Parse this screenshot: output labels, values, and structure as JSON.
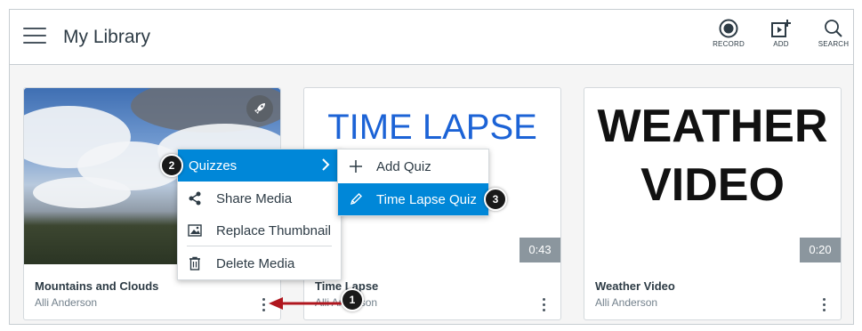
{
  "header": {
    "title": "My Library",
    "buttons": [
      {
        "label": "RECORD",
        "icon": "record-icon"
      },
      {
        "label": "ADD",
        "icon": "add-media-icon"
      },
      {
        "label": "SEARCH",
        "icon": "search-icon"
      }
    ]
  },
  "cards": [
    {
      "title": "Mountains and Clouds",
      "author": "Alli Anderson",
      "thumbnail": "photo of clouds over mountains",
      "badge_icon": "rocket-icon"
    },
    {
      "title": "Time Lapse",
      "author": "Alli Anderson",
      "thumbnail_text": "TIME LAPSE",
      "duration": "0:43"
    },
    {
      "title": "Weather Video",
      "author": "Alli Anderson",
      "thumbnail_text_line1": "WEATHER",
      "thumbnail_text_line2": "VIDEO",
      "duration": "0:20"
    }
  ],
  "context_menu": {
    "items": [
      {
        "label": "Quizzes",
        "icon": "chevron-right-icon",
        "active": true
      },
      {
        "label": "Share Media",
        "icon": "share-icon"
      },
      {
        "label": "Replace Thumbnail",
        "icon": "image-icon"
      },
      {
        "label": "Delete Media",
        "icon": "trash-icon"
      }
    ]
  },
  "quizzes_submenu": {
    "items": [
      {
        "label": "Add Quiz",
        "icon": "plus-icon"
      },
      {
        "label": "Time Lapse Quiz",
        "icon": "pencil-icon",
        "active": true
      }
    ]
  },
  "steps": [
    "1",
    "2",
    "3"
  ],
  "colors": {
    "accent": "#0087d8",
    "timelapse_text": "#1c63d6",
    "annotation_arrow": "#b0161e"
  }
}
